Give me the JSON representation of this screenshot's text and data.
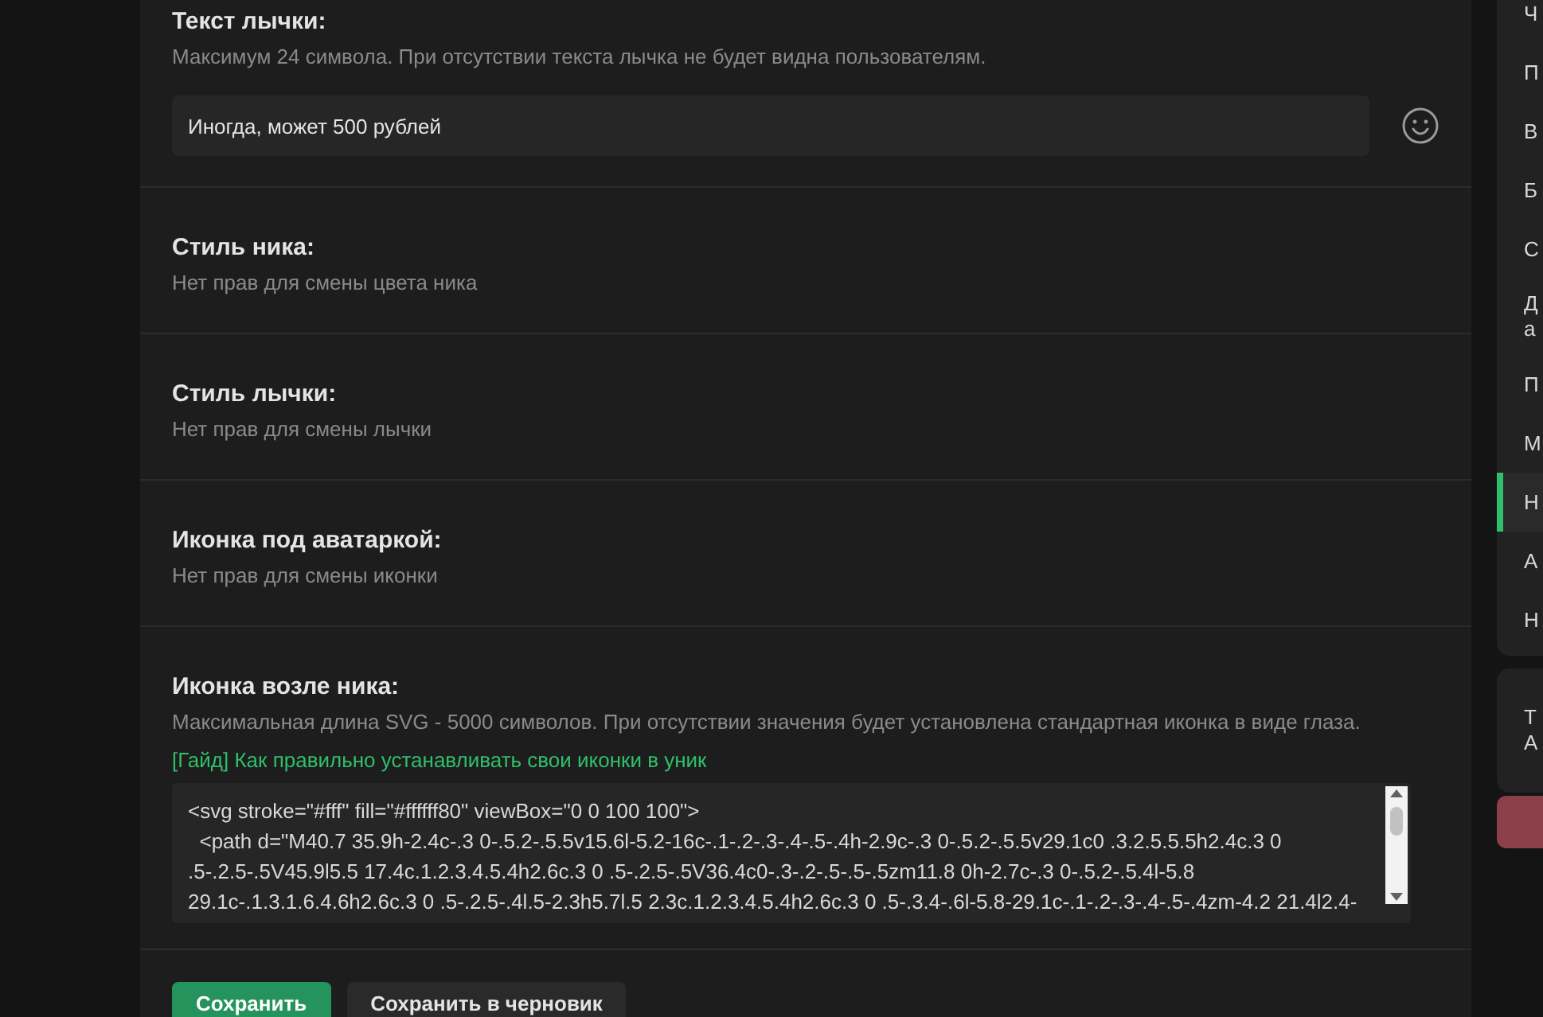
{
  "sections": [
    {
      "kind": "text_input",
      "title": "Текст лычки:",
      "hint": "Максимум 24 символа. При отсутствии текста лычка не будет видна пользователям.",
      "value": "Иногда, может 500 рублей"
    },
    {
      "kind": "note",
      "title": "Стиль ника:",
      "hint": "Нет прав для смены цвета ника"
    },
    {
      "kind": "note",
      "title": "Стиль лычки:",
      "hint": "Нет прав для смены лычки"
    },
    {
      "kind": "note",
      "title": "Иконка под аватаркой:",
      "hint": "Нет прав для смены иконки"
    },
    {
      "kind": "code",
      "title": "Иконка возле ника:",
      "hint": "Максимальная длина SVG - 5000 символов. При отсутствии значения будет установлена стандартная иконка в виде глаза.",
      "link": "[Гайд] Как правильно устанавливать свои иконки в уник",
      "value": "<svg stroke=\"#fff\" fill=\"#ffffff80\" viewBox=\"0 0 100 100\">\n  <path d=\"M40.7 35.9h-2.4c-.3 0-.5.2-.5.5v15.6l-5.2-16c-.1-.2-.3-.4-.5-.4h-2.9c-.3 0-.5.2-.5.5v29.1c0 .3.2.5.5.5h2.4c.3 0\n.5-.2.5-.5V45.9l5.5 17.4c.1.2.3.4.5.4h2.6c.3 0 .5-.2.5-.5V36.4c0-.3-.2-.5-.5-.5zm11.8 0h-2.7c-.3 0-.5.2-.5.4l-5.8\n29.1c-.1.3.1.6.4.6h2.6c.3 0 .5-.2.5-.4l.5-2.3h5.7l.5 2.3c.1.2.3.4.5.4h2.6c.3 0 .5-.3.4-.6l-5.8-29.1c-.1-.2-.3-.4-.5-.4zm-4.2 21.4l2.4-"
    }
  ],
  "buttons": [
    {
      "kind": "primary",
      "label": "Сохранить"
    },
    {
      "kind": "secondary",
      "label": "Сохранить в черновик"
    }
  ],
  "sidebar": {
    "items": [
      {
        "label": "Ч",
        "selected": false
      },
      {
        "label": "П",
        "selected": false
      },
      {
        "label": "В",
        "selected": false
      },
      {
        "label": "Б",
        "selected": false
      },
      {
        "label": "С",
        "selected": false
      },
      {
        "label": "Д\nа",
        "selected": false
      },
      {
        "label": "П",
        "selected": false
      },
      {
        "label": "М",
        "selected": false
      },
      {
        "label": "Н",
        "selected": true
      },
      {
        "label": "А",
        "selected": false
      },
      {
        "label": "Н",
        "selected": false
      }
    ],
    "card": "Т\nА"
  }
}
